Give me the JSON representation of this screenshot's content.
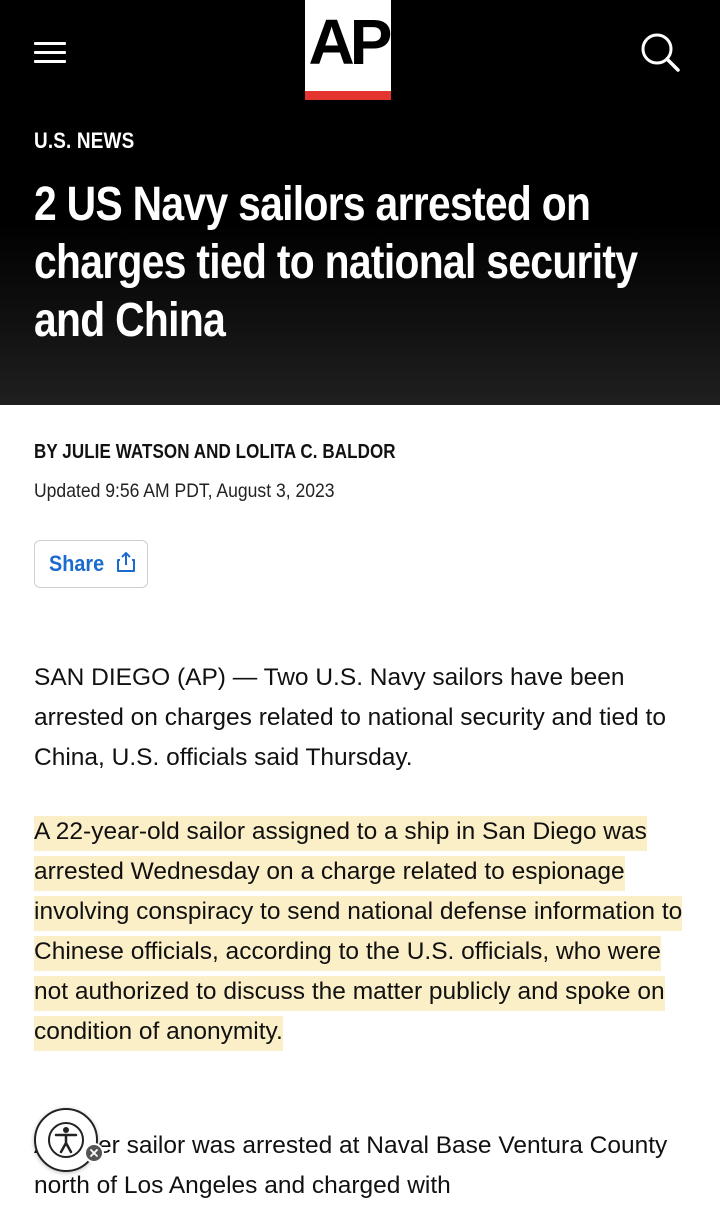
{
  "header": {
    "logo_text": "AP",
    "kicker": "U.S. NEWS",
    "headline": "2 US Navy sailors arrested on charges tied to national security and China"
  },
  "byline": {
    "authors": "BY JULIE WATSON AND LOLITA C. BALDOR",
    "updated": "Updated 9:56 AM PDT, August 3, 2023"
  },
  "share": {
    "label": "Share"
  },
  "article": {
    "paragraphs": [
      "SAN DIEGO (AP) — Two U.S. Navy sailors have been arrested on charges related to national security and tied to China, U.S. officials said Thursday.",
      "A 22-year-old sailor assigned to a ship in San Diego was arrested Wednesday on a charge related to espionage involving conspiracy to send national defense information to Chinese officials, according to the U.S. officials, who were not authorized to discuss the matter publicly and spoke on condition of anonymity.",
      "Another sailor was arrested at Naval Base Ventura County north of Los Angeles and charged with"
    ]
  },
  "colors": {
    "header_bg": "#000000",
    "accent_red": "#e3342f",
    "link_blue": "#1a6ad0",
    "highlight": "#fbefc8"
  },
  "icons": [
    "menu-icon",
    "search-icon",
    "share-icon",
    "accessibility-icon",
    "close-icon"
  ]
}
